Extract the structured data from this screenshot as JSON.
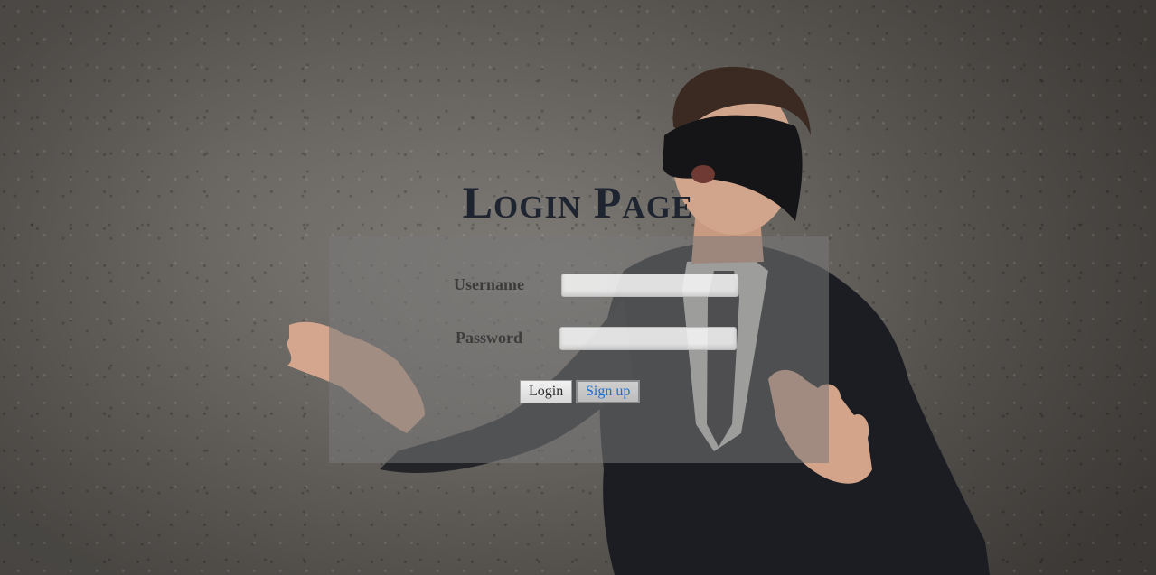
{
  "page": {
    "title": "Login Page"
  },
  "form": {
    "username_label": "Username",
    "username_value": "",
    "password_label": "Password",
    "password_value": "",
    "login_button": "Login",
    "signup_button": "Sign up"
  },
  "colors": {
    "title": "#1f2530",
    "panel": "rgba(120,120,120,0.55)",
    "signup_link": "#1a6fd1"
  }
}
